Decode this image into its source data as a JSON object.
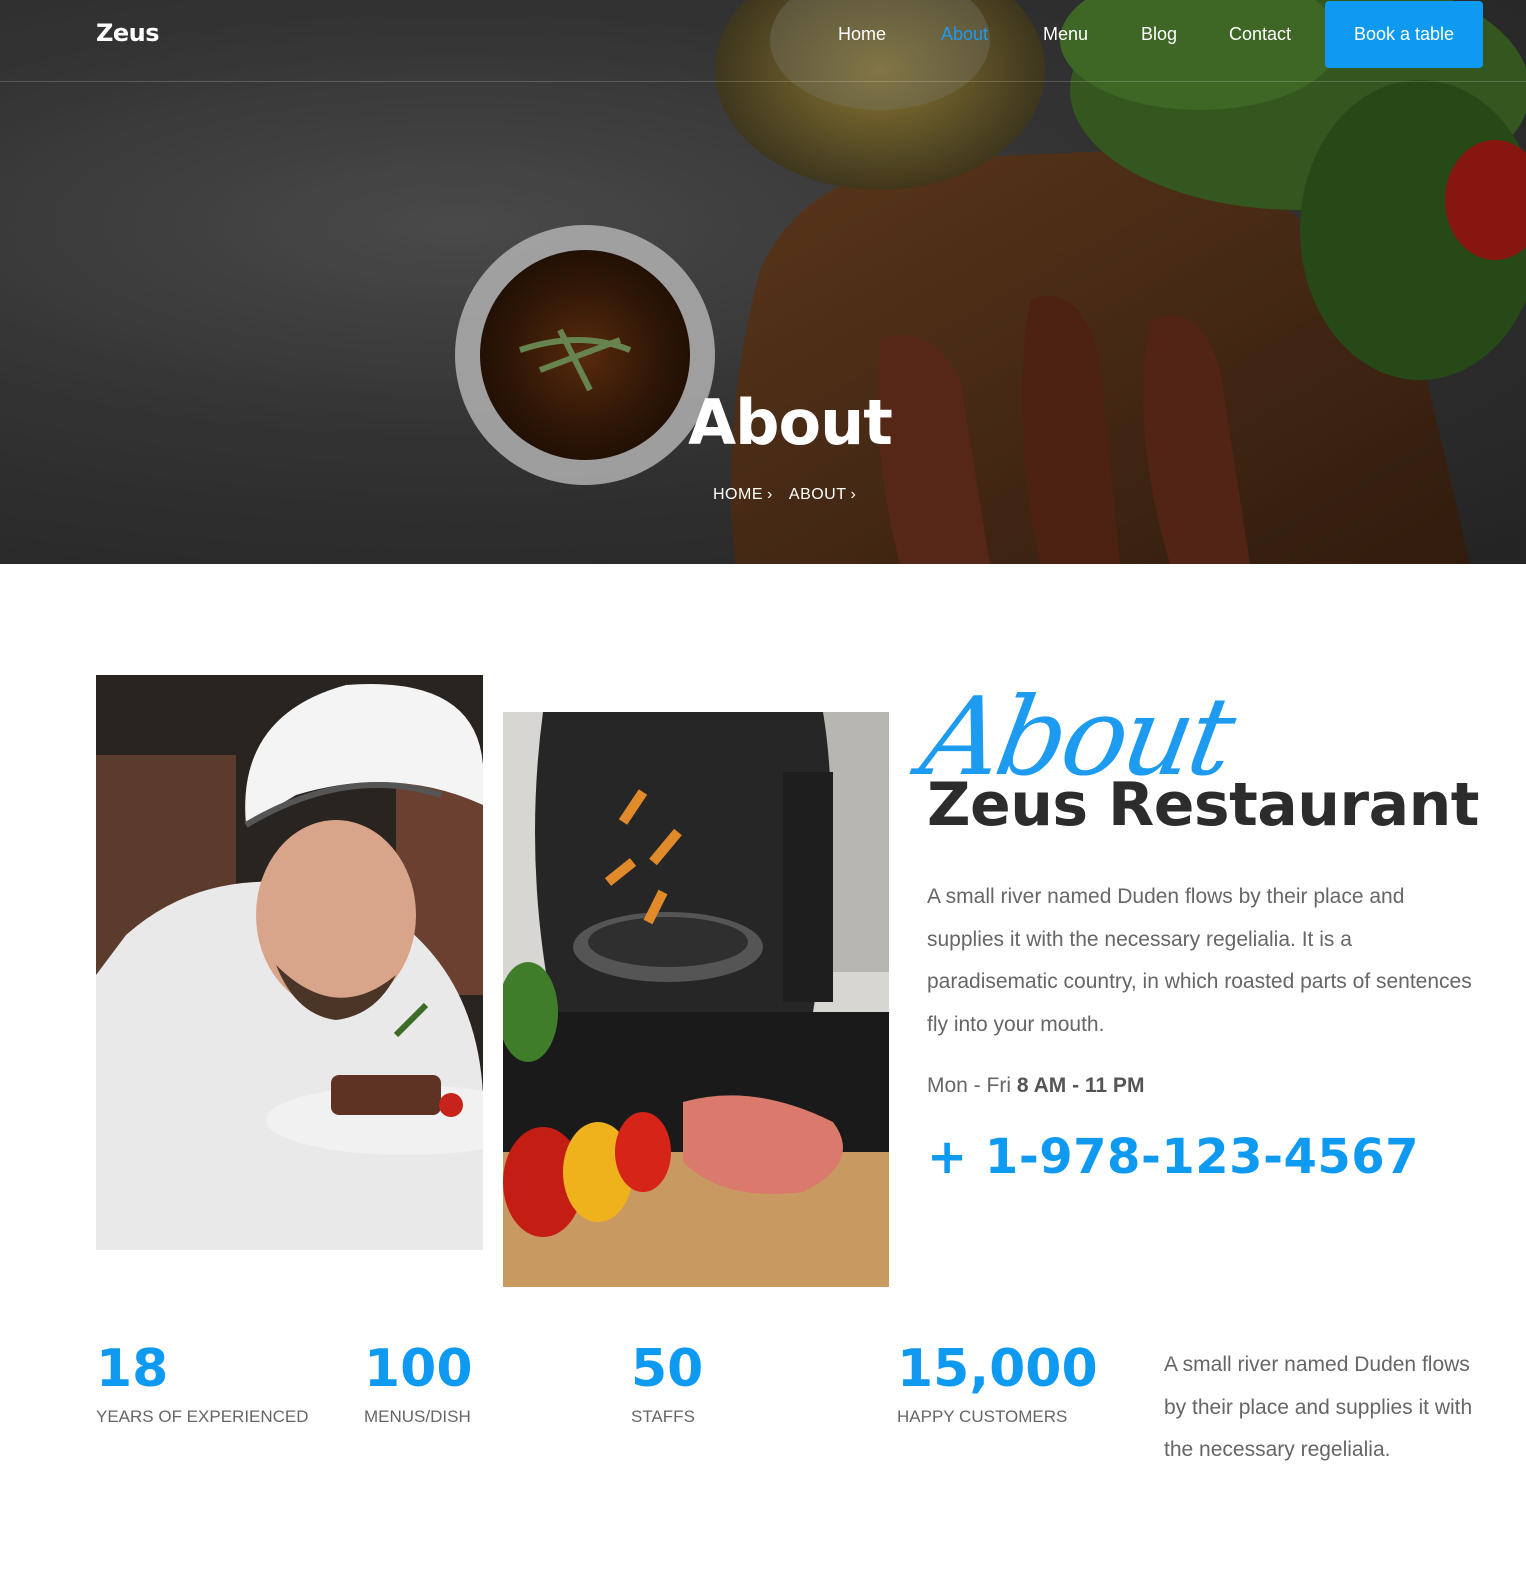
{
  "nav": {
    "brand": "Zeus",
    "items": [
      {
        "label": "Home",
        "active": false
      },
      {
        "label": "About",
        "active": true
      },
      {
        "label": "Menu",
        "active": false
      },
      {
        "label": "Blog",
        "active": false
      },
      {
        "label": "Contact",
        "active": false
      }
    ],
    "cta_label": "Book a table"
  },
  "hero": {
    "title": "About",
    "breadcrumbs": [
      "HOME",
      "ABOUT"
    ]
  },
  "about": {
    "script_label": "About",
    "heading": "Zeus Restaurant",
    "description": "A small river named Duden flows by their place and supplies it with the necessary regelialia. It is a paradisematic country, in which roasted parts of sentences fly into your mouth.",
    "hours_days": "Mon - Fri",
    "hours_time": "8 AM - 11 PM",
    "phone": "+ 1-978-123-4567"
  },
  "stats": [
    {
      "number": "18",
      "label": "YEARS OF EXPERIENCED"
    },
    {
      "number": "100",
      "label": "MENUS/DISH"
    },
    {
      "number": "50",
      "label": "STAFFS"
    },
    {
      "number": "15,000",
      "label": "HAPPY CUSTOMERS"
    }
  ],
  "stats_text": "A small river named Duden flows by their place and supplies it with the necessary regelialia.",
  "colors": {
    "accent": "#0f9af2",
    "heading": "#2c2c2c",
    "body_text": "#666666"
  },
  "icons": [
    "chevron-right-icon"
  ]
}
